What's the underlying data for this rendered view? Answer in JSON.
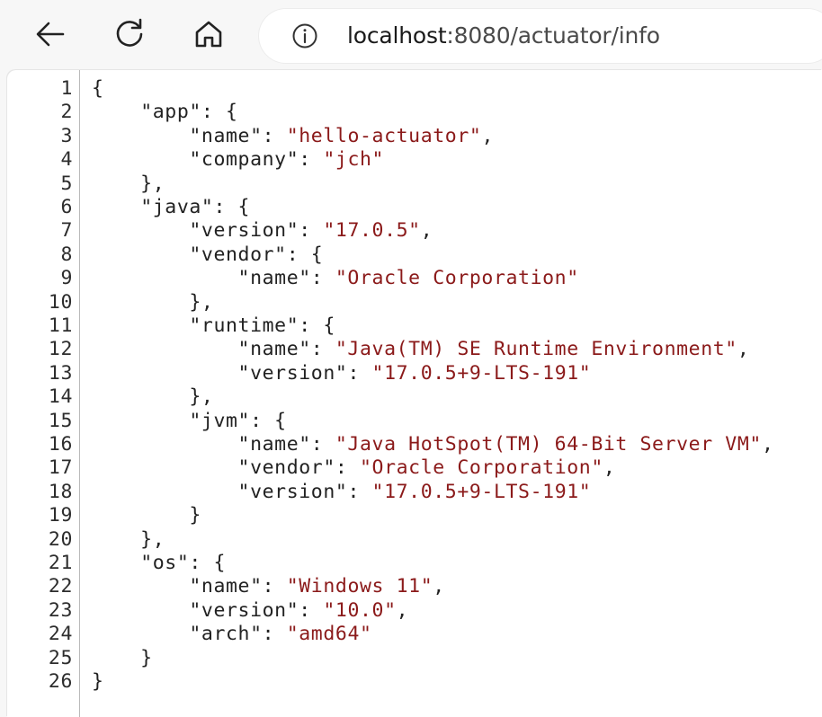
{
  "toolbar": {
    "back_icon": "arrow-left-icon",
    "reload_icon": "reload-icon",
    "home_icon": "home-icon",
    "site_info_icon": "info-circle-icon",
    "url_host": "localhost",
    "url_rest": ":8080/actuator/info"
  },
  "code": {
    "lines": [
      {
        "n": "1",
        "t": [
          [
            "p",
            "{"
          ]
        ]
      },
      {
        "n": "2",
        "t": [
          [
            "p",
            "    "
          ],
          [
            "k",
            "\"app\""
          ],
          [
            "p",
            ": {"
          ]
        ]
      },
      {
        "n": "3",
        "t": [
          [
            "p",
            "        "
          ],
          [
            "k",
            "\"name\""
          ],
          [
            "p",
            ": "
          ],
          [
            "s",
            "\"hello-actuator\""
          ],
          [
            "p",
            ","
          ]
        ]
      },
      {
        "n": "4",
        "t": [
          [
            "p",
            "        "
          ],
          [
            "k",
            "\"company\""
          ],
          [
            "p",
            ": "
          ],
          [
            "s",
            "\"jch\""
          ]
        ]
      },
      {
        "n": "5",
        "t": [
          [
            "p",
            "    },"
          ]
        ]
      },
      {
        "n": "6",
        "t": [
          [
            "p",
            "    "
          ],
          [
            "k",
            "\"java\""
          ],
          [
            "p",
            ": {"
          ]
        ]
      },
      {
        "n": "7",
        "t": [
          [
            "p",
            "        "
          ],
          [
            "k",
            "\"version\""
          ],
          [
            "p",
            ": "
          ],
          [
            "s",
            "\"17.0.5\""
          ],
          [
            "p",
            ","
          ]
        ]
      },
      {
        "n": "8",
        "t": [
          [
            "p",
            "        "
          ],
          [
            "k",
            "\"vendor\""
          ],
          [
            "p",
            ": {"
          ]
        ]
      },
      {
        "n": "9",
        "t": [
          [
            "p",
            "            "
          ],
          [
            "k",
            "\"name\""
          ],
          [
            "p",
            ": "
          ],
          [
            "s",
            "\"Oracle Corporation\""
          ]
        ]
      },
      {
        "n": "10",
        "t": [
          [
            "p",
            "        },"
          ]
        ]
      },
      {
        "n": "11",
        "t": [
          [
            "p",
            "        "
          ],
          [
            "k",
            "\"runtime\""
          ],
          [
            "p",
            ": {"
          ]
        ]
      },
      {
        "n": "12",
        "t": [
          [
            "p",
            "            "
          ],
          [
            "k",
            "\"name\""
          ],
          [
            "p",
            ": "
          ],
          [
            "s",
            "\"Java(TM) SE Runtime Environment\""
          ],
          [
            "p",
            ","
          ]
        ]
      },
      {
        "n": "13",
        "t": [
          [
            "p",
            "            "
          ],
          [
            "k",
            "\"version\""
          ],
          [
            "p",
            ": "
          ],
          [
            "s",
            "\"17.0.5+9-LTS-191\""
          ]
        ]
      },
      {
        "n": "14",
        "t": [
          [
            "p",
            "        },"
          ]
        ]
      },
      {
        "n": "15",
        "t": [
          [
            "p",
            "        "
          ],
          [
            "k",
            "\"jvm\""
          ],
          [
            "p",
            ": {"
          ]
        ]
      },
      {
        "n": "16",
        "t": [
          [
            "p",
            "            "
          ],
          [
            "k",
            "\"name\""
          ],
          [
            "p",
            ": "
          ],
          [
            "s",
            "\"Java HotSpot(TM) 64-Bit Server VM\""
          ],
          [
            "p",
            ","
          ]
        ]
      },
      {
        "n": "17",
        "t": [
          [
            "p",
            "            "
          ],
          [
            "k",
            "\"vendor\""
          ],
          [
            "p",
            ": "
          ],
          [
            "s",
            "\"Oracle Corporation\""
          ],
          [
            "p",
            ","
          ]
        ]
      },
      {
        "n": "18",
        "t": [
          [
            "p",
            "            "
          ],
          [
            "k",
            "\"version\""
          ],
          [
            "p",
            ": "
          ],
          [
            "s",
            "\"17.0.5+9-LTS-191\""
          ]
        ]
      },
      {
        "n": "19",
        "t": [
          [
            "p",
            "        }"
          ]
        ]
      },
      {
        "n": "20",
        "t": [
          [
            "p",
            "    },"
          ]
        ]
      },
      {
        "n": "21",
        "t": [
          [
            "p",
            "    "
          ],
          [
            "k",
            "\"os\""
          ],
          [
            "p",
            ": {"
          ]
        ]
      },
      {
        "n": "22",
        "t": [
          [
            "p",
            "        "
          ],
          [
            "k",
            "\"name\""
          ],
          [
            "p",
            ": "
          ],
          [
            "s",
            "\"Windows 11\""
          ],
          [
            "p",
            ","
          ]
        ]
      },
      {
        "n": "23",
        "t": [
          [
            "p",
            "        "
          ],
          [
            "k",
            "\"version\""
          ],
          [
            "p",
            ": "
          ],
          [
            "s",
            "\"10.0\""
          ],
          [
            "p",
            ","
          ]
        ]
      },
      {
        "n": "24",
        "t": [
          [
            "p",
            "        "
          ],
          [
            "k",
            "\"arch\""
          ],
          [
            "p",
            ": "
          ],
          [
            "s",
            "\"amd64\""
          ]
        ]
      },
      {
        "n": "25",
        "t": [
          [
            "p",
            "    }"
          ]
        ]
      },
      {
        "n": "26",
        "t": [
          [
            "p",
            "}"
          ]
        ]
      }
    ]
  }
}
